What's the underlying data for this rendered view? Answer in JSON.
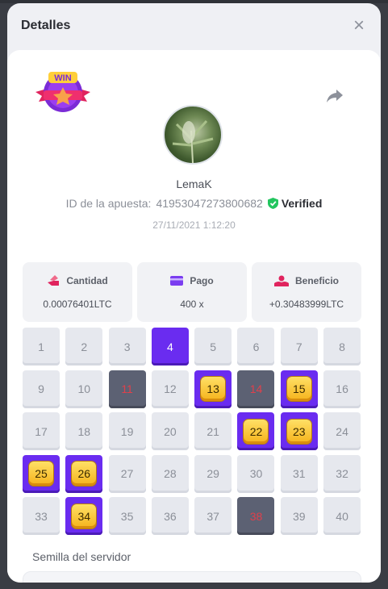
{
  "modal": {
    "title": "Detalles",
    "close": "×"
  },
  "badge": {
    "text": "WIN"
  },
  "user": {
    "name": "LemaK"
  },
  "bet": {
    "id_label": "ID de la apuesta:",
    "id": "41953047273800682",
    "verified": "Verified",
    "date": "27/11/2021 1:12:20"
  },
  "stats": [
    {
      "icon": "money-hand-icon",
      "label": "Cantidad",
      "value": "0.00076401LTC"
    },
    {
      "icon": "card-icon",
      "label": "Pago",
      "value": "400 x"
    },
    {
      "icon": "profit-hand-icon",
      "label": "Beneficio",
      "value": "+0.30483999LTC"
    }
  ],
  "grid": {
    "cells": [
      {
        "n": "1",
        "s": "n"
      },
      {
        "n": "2",
        "s": "n"
      },
      {
        "n": "3",
        "s": "n"
      },
      {
        "n": "4",
        "s": "sel"
      },
      {
        "n": "5",
        "s": "n"
      },
      {
        "n": "6",
        "s": "n"
      },
      {
        "n": "7",
        "s": "n"
      },
      {
        "n": "8",
        "s": "n"
      },
      {
        "n": "9",
        "s": "n"
      },
      {
        "n": "10",
        "s": "n"
      },
      {
        "n": "11",
        "s": "miss"
      },
      {
        "n": "12",
        "s": "n"
      },
      {
        "n": "13",
        "s": "hit"
      },
      {
        "n": "14",
        "s": "miss"
      },
      {
        "n": "15",
        "s": "hit"
      },
      {
        "n": "16",
        "s": "n"
      },
      {
        "n": "17",
        "s": "n"
      },
      {
        "n": "18",
        "s": "n"
      },
      {
        "n": "19",
        "s": "n"
      },
      {
        "n": "20",
        "s": "n"
      },
      {
        "n": "21",
        "s": "n"
      },
      {
        "n": "22",
        "s": "hit"
      },
      {
        "n": "23",
        "s": "hit"
      },
      {
        "n": "24",
        "s": "n"
      },
      {
        "n": "25",
        "s": "hit"
      },
      {
        "n": "26",
        "s": "hit"
      },
      {
        "n": "27",
        "s": "n"
      },
      {
        "n": "28",
        "s": "n"
      },
      {
        "n": "29",
        "s": "n"
      },
      {
        "n": "30",
        "s": "n"
      },
      {
        "n": "31",
        "s": "n"
      },
      {
        "n": "32",
        "s": "n"
      },
      {
        "n": "33",
        "s": "n"
      },
      {
        "n": "34",
        "s": "hit"
      },
      {
        "n": "35",
        "s": "n"
      },
      {
        "n": "36",
        "s": "n"
      },
      {
        "n": "37",
        "s": "n"
      },
      {
        "n": "38",
        "s": "miss"
      },
      {
        "n": "39",
        "s": "n"
      },
      {
        "n": "40",
        "s": "n"
      }
    ]
  },
  "seed": {
    "label": "Semilla del servidor"
  },
  "colors": {
    "accent": "#6a2cf0",
    "gem": "#f5b21a",
    "miss": "#5c6173",
    "miss_text": "#e0404b",
    "verified": "#22c55e"
  }
}
